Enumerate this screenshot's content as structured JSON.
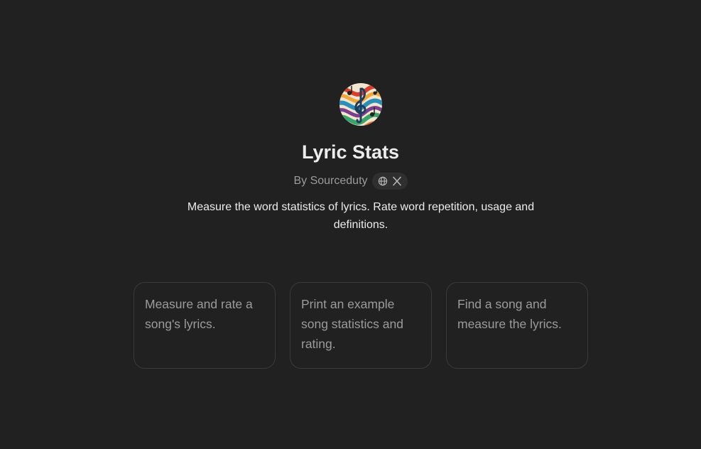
{
  "gpt": {
    "avatar_icon": "treble-clef-music-swirl",
    "title": "Lyric Stats",
    "author": "By Sourceduty",
    "link_icons": [
      "globe-icon",
      "x-logo-icon"
    ],
    "description": "Measure the word statistics of lyrics. Rate word repetition, usage and definitions."
  },
  "conversation_starters": [
    {
      "label": "Measure and rate a song's lyrics."
    },
    {
      "label": "Print an example song statistics and rating."
    },
    {
      "label": "Find a song and measure the lyrics."
    }
  ],
  "colors": {
    "background": "#212121",
    "title": "#ececec",
    "muted": "#9b9b9b",
    "card_border": "#3a3a3a",
    "pill_bg": "#2f2f2f"
  }
}
